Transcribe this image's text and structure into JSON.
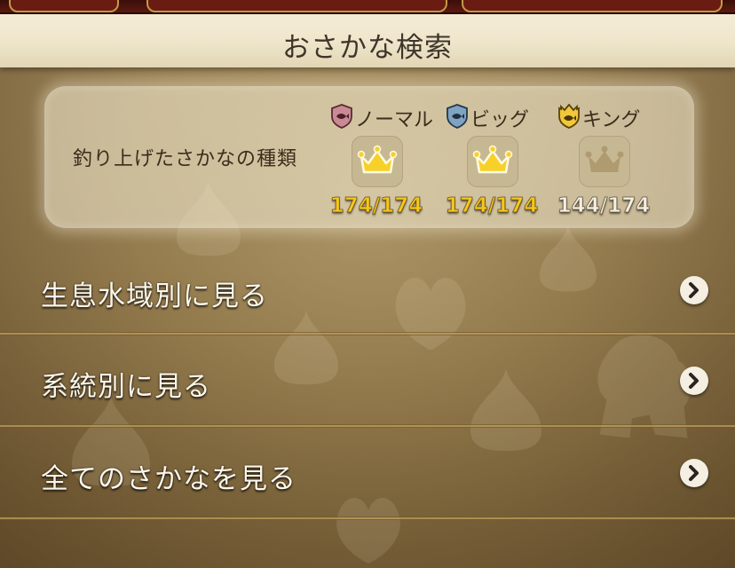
{
  "header": {
    "title": "おさかな検索"
  },
  "stats": {
    "label": "釣り上げたさかなの種類",
    "ranks": [
      {
        "name": "ノーマル",
        "icon": "pink-fish-shield-icon",
        "shield_color": "#c98a96",
        "count": "174/174",
        "complete": true
      },
      {
        "name": "ビッグ",
        "icon": "blue-fish-shield-icon",
        "shield_color": "#7fa4c2",
        "count": "174/174",
        "complete": true
      },
      {
        "name": "キング",
        "icon": "gold-fish-shield-icon",
        "shield_color": "#f0c83a",
        "count": "144/174",
        "complete": false
      }
    ]
  },
  "menu": [
    {
      "label": "生息水域別に見る",
      "icon": "chevron-right-icon"
    },
    {
      "label": "系統別に見る",
      "icon": "chevron-right-icon"
    },
    {
      "label": "全てのさかなを見る",
      "icon": "chevron-right-icon"
    }
  ],
  "colors": {
    "background": "#8f7649",
    "title_bar": "#efe6cc",
    "count_complete": "#f6c81a",
    "count_incomplete": "#f3f0e6",
    "crown_complete": "#f7d12a",
    "crown_incomplete": "#b09a70"
  }
}
